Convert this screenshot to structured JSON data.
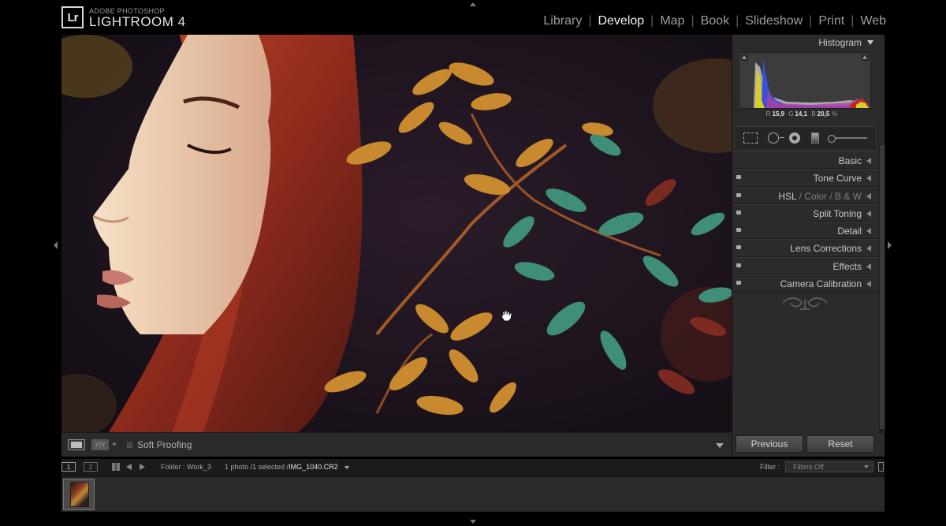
{
  "app": {
    "logo_text": "Lr",
    "brand_small": "ADOBE PHOTOSHOP",
    "brand_big": "LIGHTROOM 4"
  },
  "modules": [
    {
      "label": "Library",
      "active": false
    },
    {
      "label": "Develop",
      "active": true
    },
    {
      "label": "Map",
      "active": false
    },
    {
      "label": "Book",
      "active": false
    },
    {
      "label": "Slideshow",
      "active": false
    },
    {
      "label": "Print",
      "active": false
    },
    {
      "label": "Web",
      "active": false
    }
  ],
  "toolbar": {
    "yy_label": "Y|Y",
    "soft_proofing": "Soft Proofing"
  },
  "histogram": {
    "title": "Histogram",
    "r_label": "R",
    "r_value": "15,9",
    "g_label": "G",
    "g_value": "14,1",
    "b_label": "B",
    "b_value": "20,5",
    "unit": "%"
  },
  "panels": [
    {
      "label": "Basic",
      "switch": false
    },
    {
      "label": "Tone Curve",
      "switch": true
    },
    {
      "label": "HSL",
      "switch": true,
      "extra": [
        "Color",
        "B & W"
      ]
    },
    {
      "label": "Split Toning",
      "switch": true
    },
    {
      "label": "Detail",
      "switch": true
    },
    {
      "label": "Lens Corrections",
      "switch": true
    },
    {
      "label": "Effects",
      "switch": true
    },
    {
      "label": "Camera Calibration",
      "switch": true
    }
  ],
  "buttons": {
    "previous": "Previous",
    "reset": "Reset"
  },
  "filmstrip": {
    "screen1": "1",
    "screen2": "2",
    "folder": "Folder : Work_3",
    "count_prefix": "1 photo /1 selected /",
    "filename": "IMG_1040.CR2",
    "filter_label": "Filter :",
    "filter_value": "Filters Off"
  },
  "colors": {
    "accent_active": "#f2f2f2",
    "panel_bg": "#2b2b2b",
    "hair": "#a2311e",
    "leaf_orange": "#c98a2c",
    "leaf_teal": "#3e9a86"
  }
}
